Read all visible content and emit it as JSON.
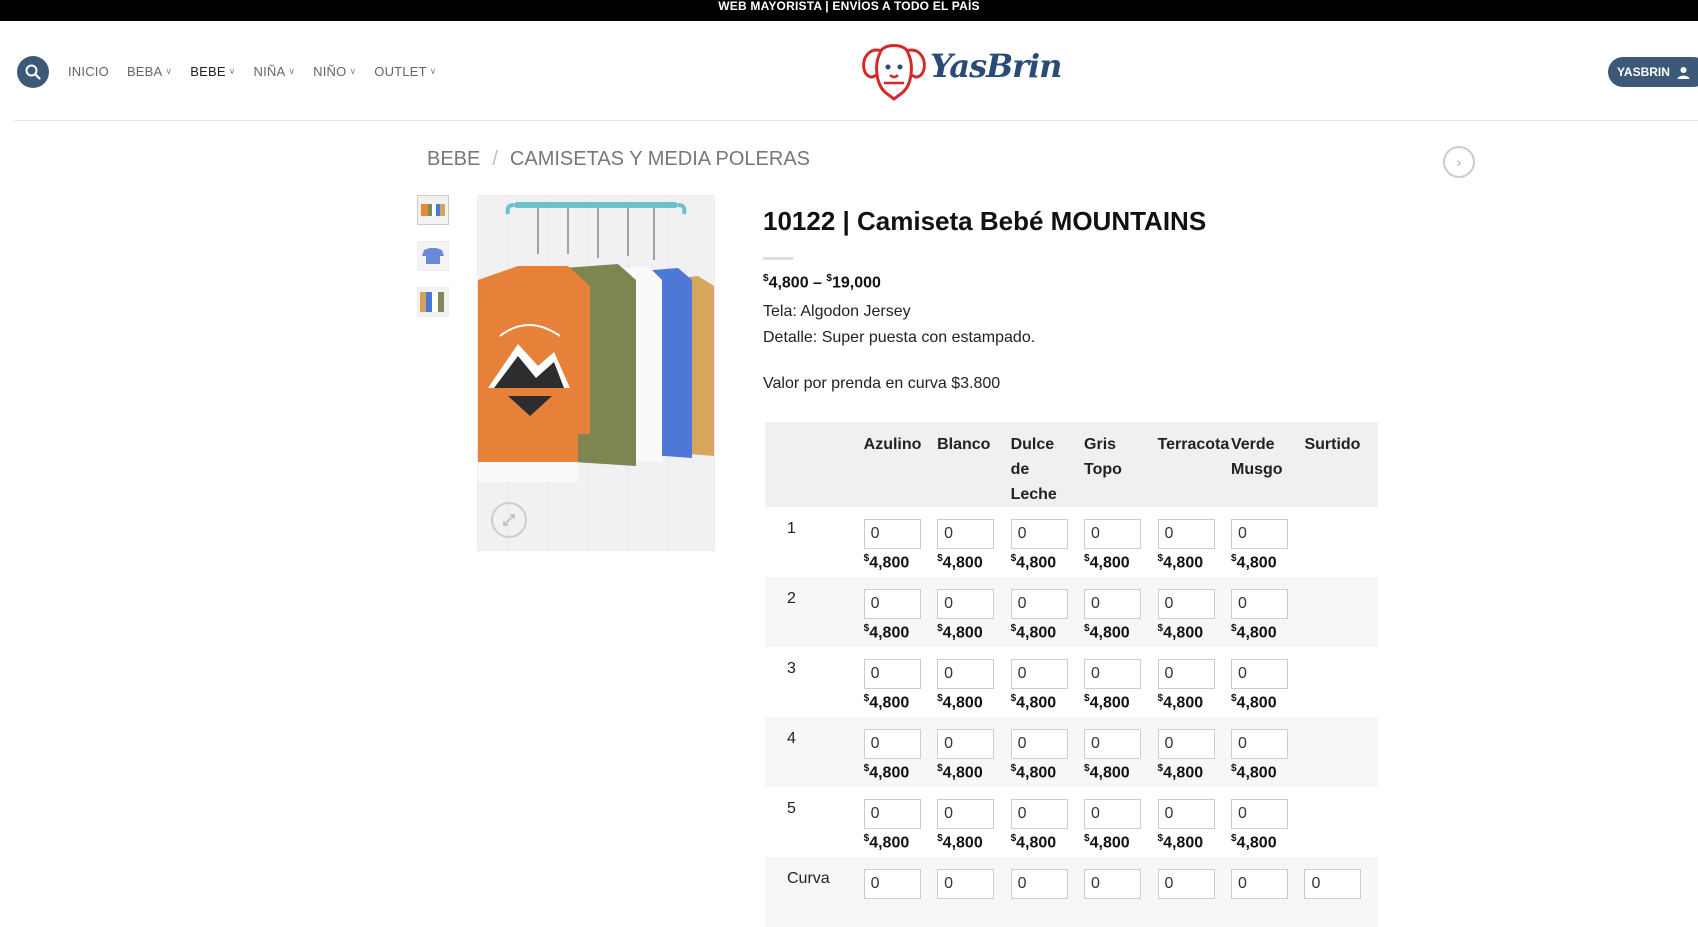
{
  "topbar": {
    "text": "WEB MAYORISTA | ENVÍOS A TODO EL PAÍS"
  },
  "header": {
    "nav": [
      {
        "label": "INICIO",
        "has_dropdown": false,
        "active": false
      },
      {
        "label": "BEBA",
        "has_dropdown": true,
        "active": false
      },
      {
        "label": "BEBE",
        "has_dropdown": true,
        "active": true
      },
      {
        "label": "NIÑA",
        "has_dropdown": true,
        "active": false
      },
      {
        "label": "NIÑO",
        "has_dropdown": true,
        "active": false
      },
      {
        "label": "OUTLET",
        "has_dropdown": true,
        "active": false
      }
    ],
    "logo_text": "YasBrin",
    "account_label": "YASBRIN",
    "search_icon": "search-icon",
    "user_icon": "user-icon"
  },
  "breadcrumb": {
    "items": [
      "BEBE",
      "CAMISETAS Y MEDIA POLERAS"
    ],
    "separator": "/"
  },
  "product": {
    "title": "10122 | Camiseta Bebé MOUNTAINS",
    "price_min_symbol": "$",
    "price_min": "4,800",
    "price_dash": " – ",
    "price_max_symbol": "$",
    "price_max": "19,000",
    "fabric": "Tela: Algodon Jersey",
    "detail": "Detalle: Super puesta con estampado.",
    "curve_value": "Valor por prenda en curva $3.800"
  },
  "variant_table": {
    "columns": [
      [
        "Azulino"
      ],
      [
        "Blanco"
      ],
      [
        "Dulce",
        "de",
        "Leche"
      ],
      [
        "Gris",
        "Topo"
      ],
      [
        "Terracota"
      ],
      [
        "Verde",
        "Musgo"
      ],
      [
        "Surtido"
      ]
    ],
    "rows": [
      {
        "label": "1",
        "values": [
          "0",
          "0",
          "0",
          "0",
          "0",
          "0"
        ],
        "price_symbol": "$",
        "price": "4,800"
      },
      {
        "label": "2",
        "values": [
          "0",
          "0",
          "0",
          "0",
          "0",
          "0"
        ],
        "price_symbol": "$",
        "price": "4,800"
      },
      {
        "label": "3",
        "values": [
          "0",
          "0",
          "0",
          "0",
          "0",
          "0"
        ],
        "price_symbol": "$",
        "price": "4,800"
      },
      {
        "label": "4",
        "values": [
          "0",
          "0",
          "0",
          "0",
          "0",
          "0"
        ],
        "price_symbol": "$",
        "price": "4,800"
      },
      {
        "label": "5",
        "values": [
          "0",
          "0",
          "0",
          "0",
          "0",
          "0"
        ],
        "price_symbol": "$",
        "price": "4,800"
      }
    ],
    "last_row": {
      "label": "Curva",
      "values": [
        "0",
        "0",
        "0",
        "0",
        "0",
        "0",
        "0"
      ]
    }
  },
  "colors": {
    "accent": "#3c5a78",
    "logo_red": "#d42a2a",
    "logo_blue": "#2a4a78"
  }
}
